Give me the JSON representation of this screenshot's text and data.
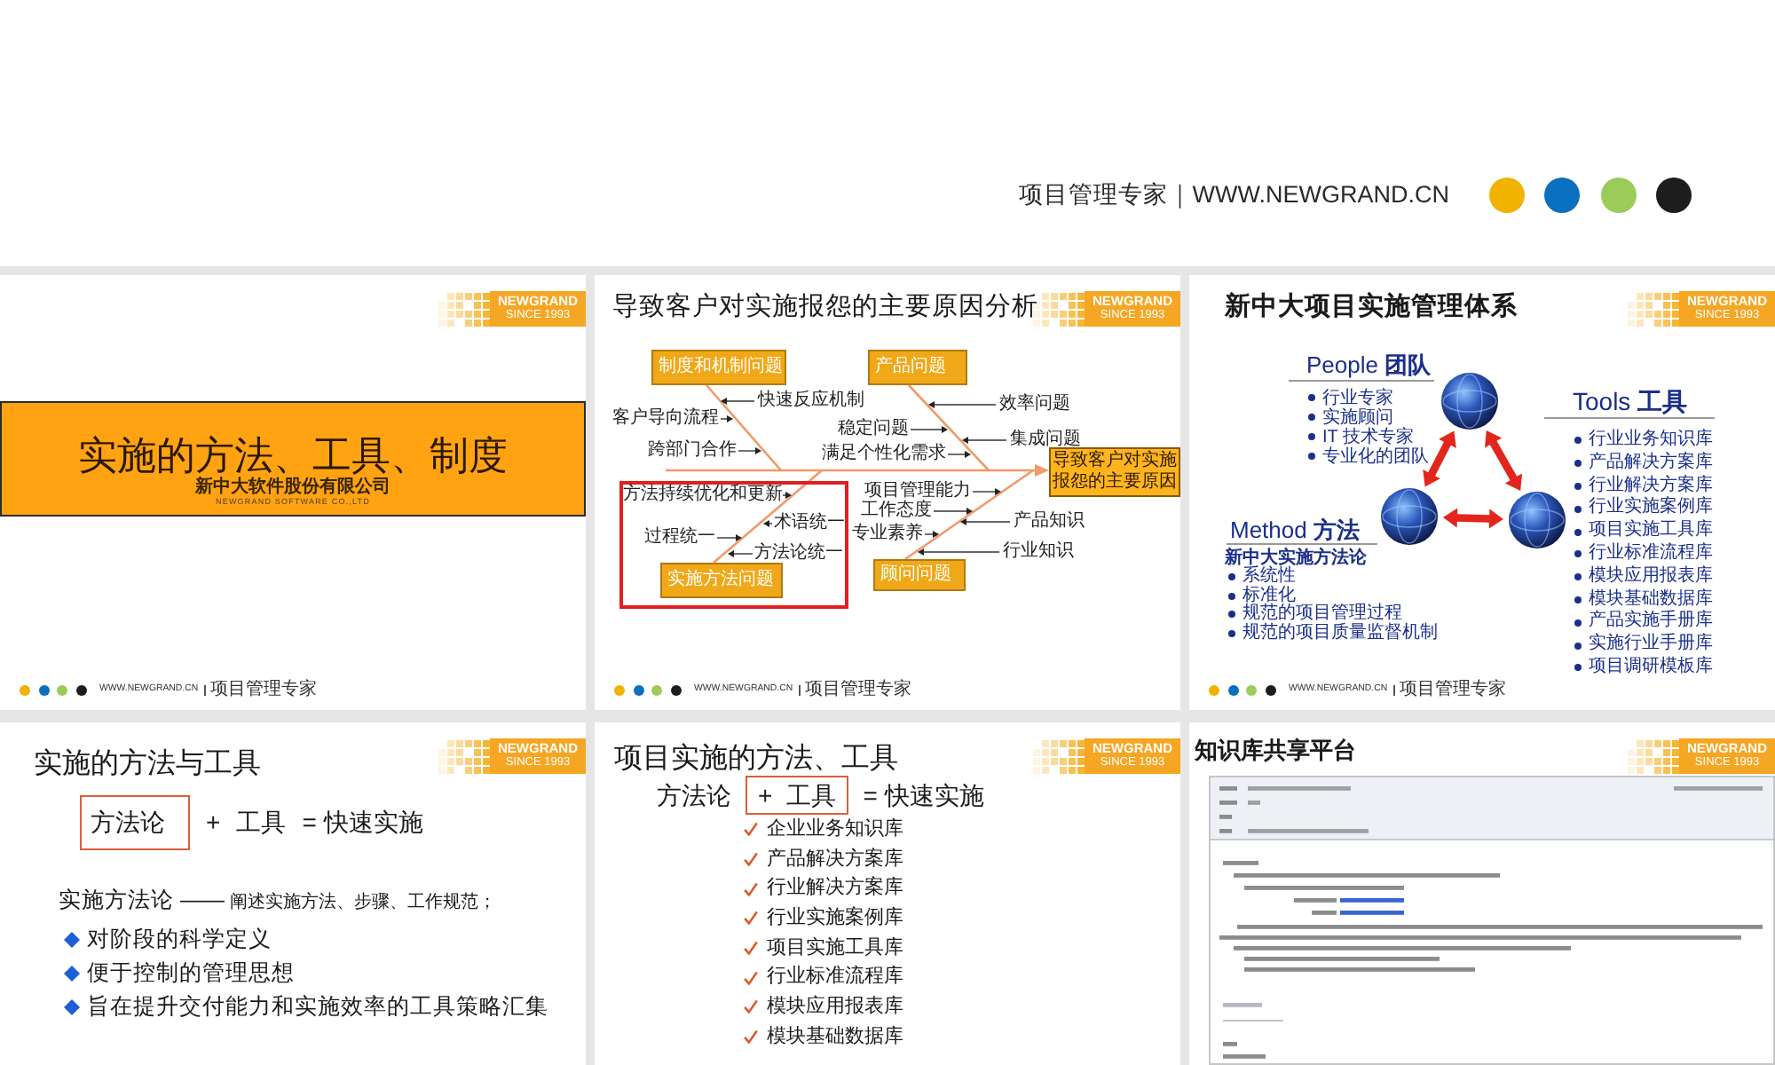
{
  "header": {
    "tagline": "项目管理专家｜WWW.NEWGRAND.CN",
    "dots": [
      {
        "color": "#f2b300"
      },
      {
        "color": "#0b6fbf"
      },
      {
        "color": "#9ccb5a"
      },
      {
        "color": "#1d1d1d"
      }
    ]
  },
  "slides": [
    {
      "kind": "title",
      "logo": {
        "brand": "NEWGRAND",
        "since": "SINCE 1993"
      },
      "title": "实施的方法、工具、制度",
      "company": "新中大软件股份有限公司",
      "company_en": "NEWGRAND SOFTWARE CO.,LTD",
      "footer": {
        "dots": [
          {
            "color": "#f2b300"
          },
          {
            "color": "#0b6fbf"
          },
          {
            "color": "#9ccb5a"
          },
          {
            "color": "#1d1d1d"
          }
        ],
        "url": "WWW.NEWGRAND.CN",
        "tagline": "项目管理专家"
      }
    },
    {
      "kind": "fishbone",
      "title": "导致客户对实施报怨的主要原因分析",
      "logo": {
        "brand": "NEWGRAND",
        "since": "SINCE 1993"
      },
      "fishbone": {
        "effect": "导致客户对实施报怨的主要原因",
        "branches": [
          {
            "label": "制度和机制问题",
            "highlighted": false,
            "factors": [
              "快速反应机制",
              "客户导向流程",
              "跨部门合作"
            ]
          },
          {
            "label": "产品问题",
            "highlighted": false,
            "factors": [
              "效率问题",
              "稳定问题",
              "集成问题",
              "满足个性化需求"
            ]
          },
          {
            "label": "实施方法问题",
            "highlighted": true,
            "factors": [
              "方法持续优化和更新",
              "术语统一",
              "过程统一",
              "方法论统一"
            ]
          },
          {
            "label": "顾问问题",
            "highlighted": false,
            "factors": [
              "项目管理能力",
              "工作态度",
              "产品知识",
              "专业素养",
              "行业知识"
            ]
          }
        ]
      },
      "footer": {
        "dots": [
          {
            "color": "#f2b300"
          },
          {
            "color": "#0b6fbf"
          },
          {
            "color": "#9ccb5a"
          },
          {
            "color": "#1d1d1d"
          }
        ],
        "url": "WWW.NEWGRAND.CN",
        "tagline": "项目管理专家"
      }
    },
    {
      "kind": "system",
      "title": "新中大项目实施管理体系",
      "logo": {
        "brand": "NEWGRAND",
        "since": "SINCE 1993"
      },
      "people": {
        "heading": "People **团队**",
        "items": [
          "行业专家",
          "实施顾问",
          "IT 技术专家",
          "专业化的团队"
        ]
      },
      "tools": {
        "heading": "Tools **工具**",
        "items": [
          "行业业务知识库",
          "产品解决方案库",
          "行业解决方案库",
          "行业实施案例库",
          "项目实施工具库",
          "行业标准流程库",
          "模块应用报表库",
          "模块基础数据库",
          "产品实施手册库",
          "实施行业手册库",
          "项目调研模板库"
        ]
      },
      "method": {
        "heading": "Method **方法**",
        "subtitle": "新中大实施方法论",
        "items": [
          "系统性",
          "标准化",
          "规范的项目管理过程",
          "规范的项目质量监督机制"
        ]
      },
      "footer": {
        "dots": [
          {
            "color": "#f2b300"
          },
          {
            "color": "#0b6fbf"
          },
          {
            "color": "#9ccb5a"
          },
          {
            "color": "#1d1d1d"
          }
        ],
        "url": "WWW.NEWGRAND.CN",
        "tagline": "项目管理专家"
      }
    },
    {
      "kind": "formula",
      "title": "实施的方法与工具",
      "logo": {
        "brand": "NEWGRAND",
        "since": "SINCE 1993"
      },
      "formula": {
        "terms": [
          {
            "text": "方法论",
            "framed": true
          },
          {
            "text": "+",
            "framed": false
          },
          {
            "text": "工具",
            "framed": false
          },
          {
            "text": "= 快速实施",
            "framed": false
          }
        ]
      },
      "definition": {
        "term": "实施方法论 ——",
        "text": "阐述实施方法、步骤、工作规范；"
      },
      "points": [
        "对阶段的科学定义",
        "便于控制的管理思想",
        "旨在提升交付能力和实施效率的工具策略汇集"
      ]
    },
    {
      "kind": "checklist",
      "title": "项目实施的方法、工具",
      "logo": {
        "brand": "NEWGRAND",
        "since": "SINCE 1993"
      },
      "formula": {
        "terms": [
          {
            "text": "方法论",
            "framed": false
          },
          {
            "text": "+",
            "framed": true
          },
          {
            "text": "工具",
            "framed": true
          },
          {
            "text": "= 快速实施",
            "framed": false
          }
        ]
      },
      "checklist": [
        "企业业务知识库",
        "产品解决方案库",
        "行业解决方案库",
        "行业实施案例库",
        "项目实施工具库",
        "行业标准流程库",
        "模块应用报表库",
        "模块基础数据库"
      ]
    },
    {
      "kind": "screenshot",
      "title": "知识库共享平台",
      "logo": {
        "brand": "NEWGRAND",
        "since": "SINCE 1993"
      }
    }
  ]
}
